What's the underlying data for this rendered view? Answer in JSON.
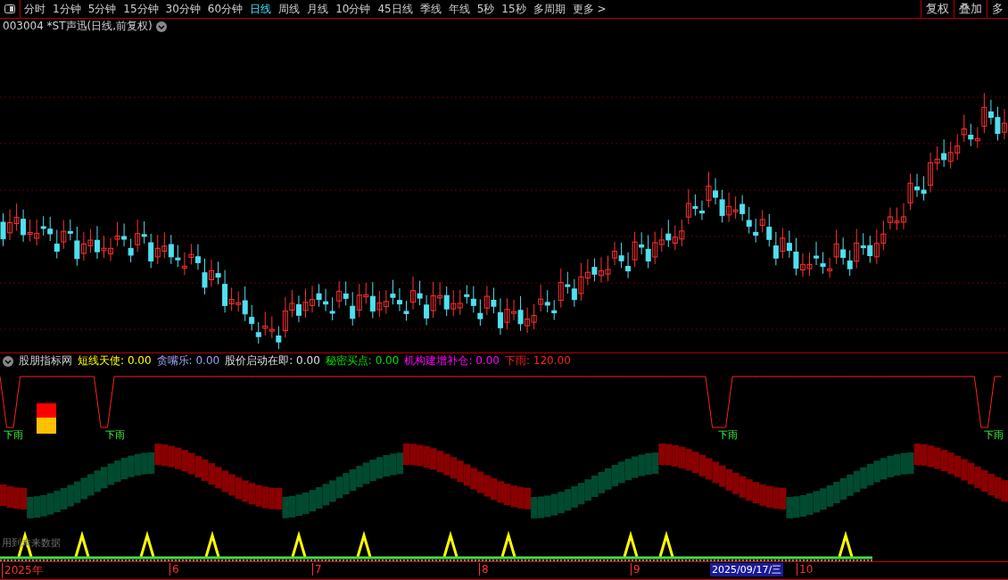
{
  "toolbar": {
    "periods": [
      {
        "label": "分时",
        "selected": false
      },
      {
        "label": "1分钟",
        "selected": false
      },
      {
        "label": "5分钟",
        "selected": false
      },
      {
        "label": "15分钟",
        "selected": false
      },
      {
        "label": "30分钟",
        "selected": false
      },
      {
        "label": "60分钟",
        "selected": false
      },
      {
        "label": "日线",
        "selected": true
      },
      {
        "label": "周线",
        "selected": false
      },
      {
        "label": "月线",
        "selected": false
      },
      {
        "label": "10分钟",
        "selected": false
      },
      {
        "label": "45日线",
        "selected": false
      },
      {
        "label": "季线",
        "selected": false
      },
      {
        "label": "年线",
        "selected": false
      },
      {
        "label": "5秒",
        "selected": false
      },
      {
        "label": "15秒",
        "selected": false
      },
      {
        "label": "多周期",
        "selected": false
      }
    ],
    "more": "更多 >",
    "right_buttons": [
      "复权",
      "叠加",
      "多"
    ]
  },
  "chart_title": "003004 *ST声迅(日线,前复权)",
  "indicator": {
    "name": "股朋指标网",
    "values": [
      {
        "label": "短线天使:",
        "value": "0.00",
        "color": "#ffff00"
      },
      {
        "label": "贪嘴乐:",
        "value": "0.00",
        "color": "#a0a0ff"
      },
      {
        "label": "股价启动在即:",
        "value": "0.00",
        "color": "#e0e0e0"
      },
      {
        "label": "秘密买点:",
        "value": "0.00",
        "color": "#00e000"
      },
      {
        "label": "机构建增补仓:",
        "value": "0.00",
        "color": "#ff00ff"
      },
      {
        "label": "下雨:",
        "value": "120.00",
        "color": "#ff2020"
      }
    ],
    "rain_labels": [
      "下雨",
      "下雨",
      "下雨",
      "下雨"
    ],
    "note": "用到未来数据"
  },
  "date_axis": {
    "labels": [
      "2025年",
      "6",
      "7",
      "8",
      "9"
    ],
    "cursor_date": "2025/09/17/三",
    "after_cursor": "10"
  }
}
